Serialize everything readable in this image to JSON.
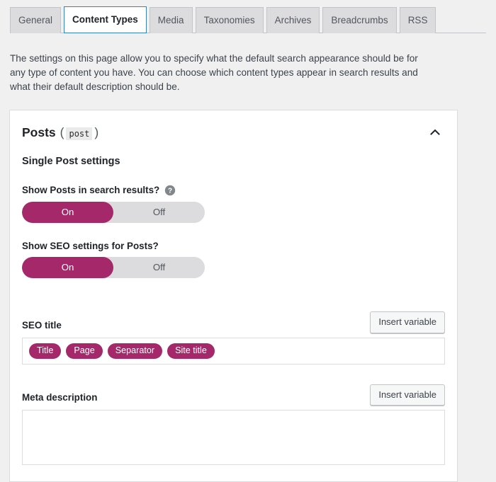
{
  "tabs": [
    {
      "label": "General",
      "active": false
    },
    {
      "label": "Content Types",
      "active": true
    },
    {
      "label": "Media",
      "active": false
    },
    {
      "label": "Taxonomies",
      "active": false
    },
    {
      "label": "Archives",
      "active": false
    },
    {
      "label": "Breadcrumbs",
      "active": false
    },
    {
      "label": "RSS",
      "active": false
    }
  ],
  "intro": {
    "text": "The settings on this page allow you to specify what the default search appearance should be for any type of content you have. You can choose which content types appear in search results and what their default description should be."
  },
  "card": {
    "title_name": "Posts",
    "paren_open": "(",
    "slug": "post",
    "paren_close": ")",
    "collapse_icon": "chevron-up-icon",
    "section_title": "Single Post settings",
    "fields": {
      "show_posts": {
        "label": "Show Posts in search results?",
        "help_icon": "help-circle-icon",
        "on_label": "On",
        "off_label": "Off",
        "value": "On"
      },
      "show_seo": {
        "label": "Show SEO settings for Posts?",
        "on_label": "On",
        "off_label": "Off",
        "value": "On"
      },
      "seo_title": {
        "label": "SEO title",
        "insert_variable_label": "Insert variable",
        "variables": [
          "Title",
          "Page",
          "Separator",
          "Site title"
        ]
      },
      "meta_description": {
        "label": "Meta description",
        "insert_variable_label": "Insert variable",
        "value": "",
        "placeholder": ""
      }
    }
  },
  "colors": {
    "accent": "#a4286a",
    "tab_active_border": "#3582c4",
    "page_background": "#f0f0f1",
    "card_background": "#ffffff",
    "toggle_track": "#dcdcde"
  }
}
